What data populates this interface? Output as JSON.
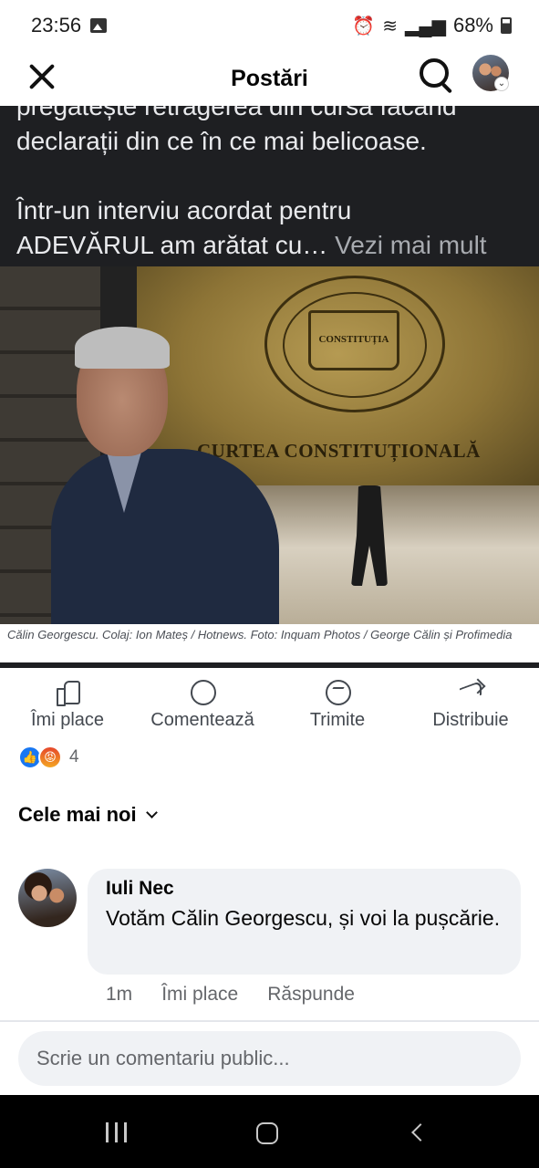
{
  "status_bar": {
    "time": "23:56",
    "battery": "68%"
  },
  "header": {
    "title": "Postări"
  },
  "post": {
    "text_line_1": "pregătește retragerea din cursa făcând",
    "text_line_2": "declarații din ce în ce mai belicoase.",
    "text_line_3": "Într-un interviu acordat pentru",
    "text_line_4": "ADEVĂRUL am arătat cu…",
    "see_more": "Vezi mai mult",
    "image_book_label": "CONSTITUȚIA",
    "image_court_name": "CURTEA CONSTITUȚIONALĂ",
    "caption": "Călin Georgescu. Colaj: Ion Mateș / Hotnews. Foto: Inquam Photos / George Călin și Profimedia"
  },
  "actions": {
    "like": "Îmi place",
    "comment": "Comentează",
    "send": "Trimite",
    "share": "Distribuie"
  },
  "reactions": {
    "count": "4"
  },
  "sort": {
    "label": "Cele mai noi"
  },
  "comments": [
    {
      "author": "Iuli Nec",
      "text": "Votăm Călin Georgescu,  și voi la pușcărie.",
      "time": "1m",
      "like": "Îmi place",
      "reply": "Răspunde"
    }
  ],
  "composer": {
    "placeholder": "Scrie un comentariu public..."
  },
  "icons": {
    "close": "close-icon",
    "search": "search-icon",
    "like": "thumbs-up-icon",
    "comment": "comment-icon",
    "send": "messenger-icon",
    "share": "share-icon"
  },
  "colors": {
    "accent": "#1877f2",
    "dark_band": "#1e1f22",
    "bubble": "#f0f2f5"
  }
}
